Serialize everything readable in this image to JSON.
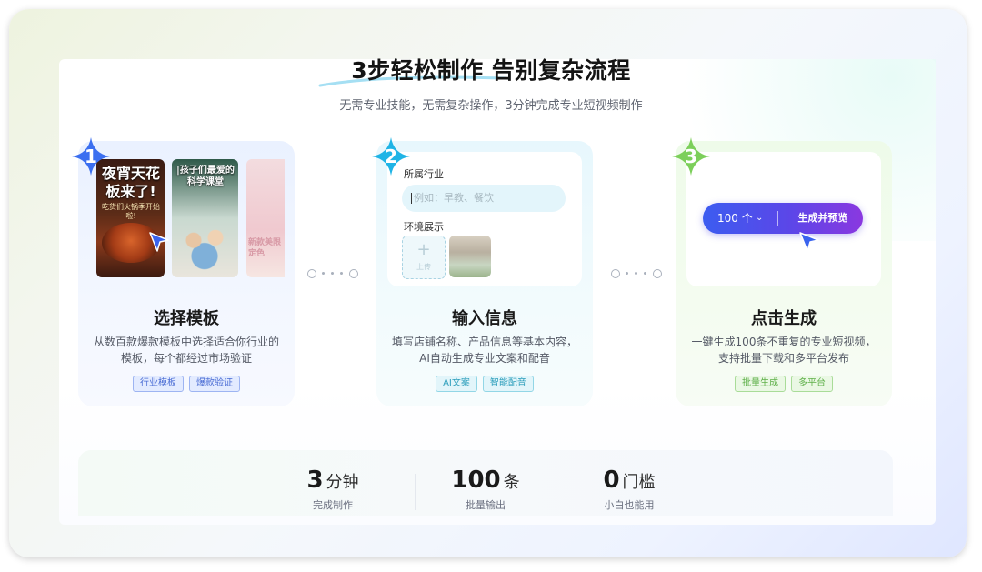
{
  "hero": {
    "title": "3步轻松制作 告别复杂流程",
    "subtitle": "无需专业技能，无需复杂操作，3分钟完成专业短视频制作"
  },
  "steps": [
    {
      "number": "1",
      "title": "选择模板",
      "desc_line1": "从数百款爆款模板中选择适合你行业的",
      "desc_line2": "模板，每个都经过市场验证",
      "tags": [
        "行业模板",
        "爆款验证"
      ],
      "color": "#3b6ff0",
      "templates": [
        {
          "headline": "夜宵天花板来了!",
          "caption": "吃货们火锅季开始啦!"
        },
        {
          "headline": "|孩子们最爱的科学课堂"
        },
        {
          "headline": "新款美限定色"
        }
      ]
    },
    {
      "number": "2",
      "title": "输入信息",
      "desc_line1": "填写店铺名称、产品信息等基本内容，",
      "desc_line2": "AI自动生成专业文案和配音",
      "tags": [
        "AI文案",
        "智能配音"
      ],
      "color": "#1fb4e6",
      "form": {
        "industry_label": "所属行业",
        "industry_placeholder": "例如：早教、餐饮",
        "environment_label": "环境展示",
        "upload_label": "上传"
      }
    },
    {
      "number": "3",
      "title": "点击生成",
      "desc_line1": "一键生成100条不重复的专业短视频，",
      "desc_line2": "支持批量下载和多平台发布",
      "tags": [
        "批量生成",
        "多平台"
      ],
      "color": "#7ccf5a",
      "generator": {
        "count": "100 个",
        "chevron": "⌄",
        "button": "生成并预览"
      }
    }
  ],
  "stats": [
    {
      "value": "3",
      "unit": "分钟",
      "label": "完成制作"
    },
    {
      "value": "100",
      "unit": "条",
      "label": "批量输出"
    },
    {
      "value": "0",
      "unit": "门槛",
      "label": "小白也能用"
    }
  ],
  "colors": {
    "pill_start": "#3c5cf0",
    "pill_end": "#8a38e0"
  }
}
